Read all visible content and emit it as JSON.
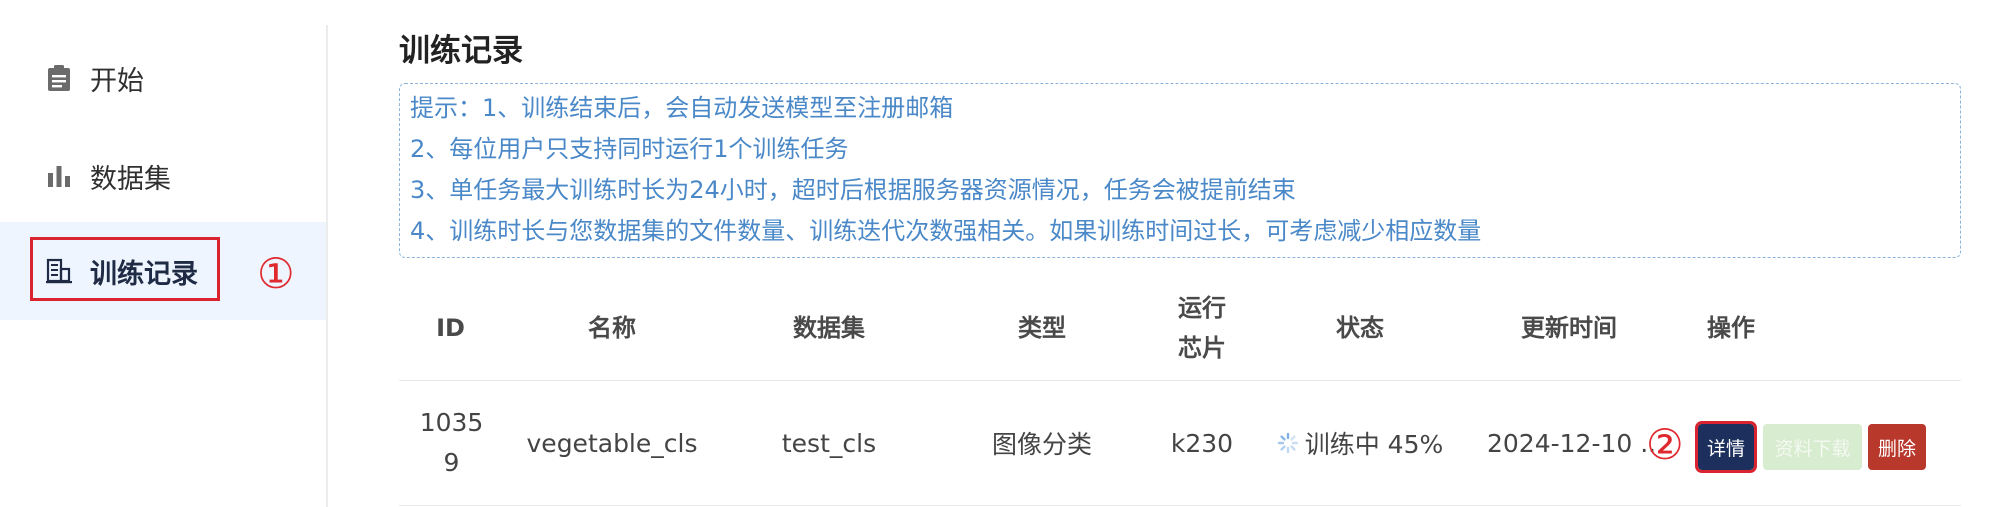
{
  "sidebar": {
    "items": [
      {
        "label": "开始",
        "icon": "clipboard-icon"
      },
      {
        "label": "数据集",
        "icon": "bar-chart-icon"
      },
      {
        "label": "训练记录",
        "icon": "building-list-icon"
      }
    ],
    "active_index": 2
  },
  "markers": {
    "one": "①",
    "two": "②"
  },
  "page": {
    "title": "训练记录"
  },
  "tips": [
    "提示：1、训练结束后，会自动发送模型至注册邮箱",
    "2、每位用户只支持同时运行1个训练任务",
    "3、单任务最大训练时长为24小时，超时后根据服务器资源情况，任务会被提前结束",
    "4、训练时长与您数据集的文件数量、训练迭代次数强相关。如果训练时间过长，可考虑减少相应数量"
  ],
  "table": {
    "headers": {
      "id": "ID",
      "name": "名称",
      "dataset": "数据集",
      "type": "类型",
      "chip_line1": "运行",
      "chip_line2": "芯片",
      "status": "状态",
      "updated": "更新时间",
      "actions": "操作"
    },
    "rows": [
      {
        "id": "10359",
        "name": "vegetable_cls",
        "dataset": "test_cls",
        "type": "图像分类",
        "chip": "k230",
        "status": "训练中 45%",
        "progress_percent": 45,
        "updated": "2024-12-10 ..",
        "buttons": {
          "detail": "详情",
          "download": "资料下载",
          "delete": "删除"
        }
      }
    ]
  },
  "colors": {
    "tip_text": "#4a88c8",
    "highlight_red": "#d9232e",
    "detail_button": "#1d2f5c",
    "download_button": "#d8ecd0",
    "delete_button": "#b9382c",
    "active_bg": "#eef5ff"
  }
}
